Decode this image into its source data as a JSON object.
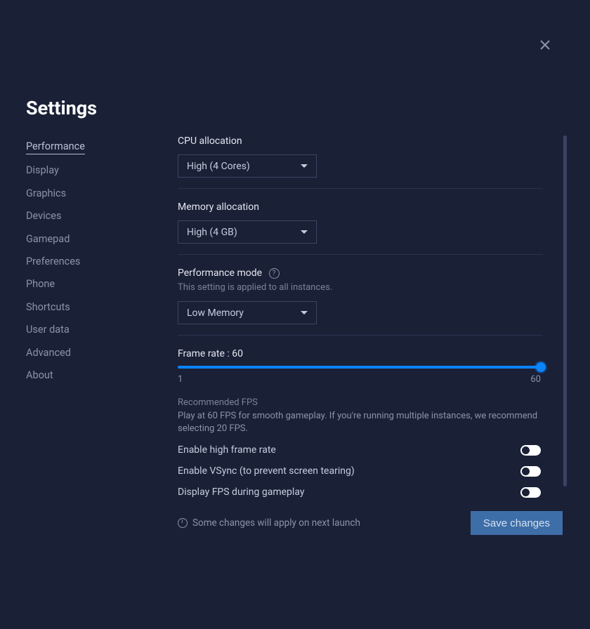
{
  "header": {
    "title": "Settings"
  },
  "sidebar": {
    "items": [
      {
        "label": "Performance",
        "active": true
      },
      {
        "label": "Display"
      },
      {
        "label": "Graphics"
      },
      {
        "label": "Devices"
      },
      {
        "label": "Gamepad"
      },
      {
        "label": "Preferences"
      },
      {
        "label": "Phone"
      },
      {
        "label": "Shortcuts"
      },
      {
        "label": "User data"
      },
      {
        "label": "Advanced"
      },
      {
        "label": "About"
      }
    ]
  },
  "main": {
    "cpu": {
      "label": "CPU allocation",
      "value": "High (4 Cores)"
    },
    "memory": {
      "label": "Memory allocation",
      "value": "High (4 GB)"
    },
    "perfmode": {
      "label": "Performance mode",
      "sub": "This setting is applied to all instances.",
      "value": "Low Memory"
    },
    "framerate": {
      "label": "Frame rate : 60",
      "min": "1",
      "max": "60",
      "reco_title": "Recommended FPS",
      "reco_body": "Play at 60 FPS for smooth gameplay. If you're running multiple instances, we recommend selecting 20 FPS."
    },
    "toggles": {
      "high_fps": "Enable high frame rate",
      "vsync": "Enable VSync (to prevent screen tearing)",
      "display_fps": "Display FPS during gameplay"
    }
  },
  "footer": {
    "note": "Some changes will apply on next launch",
    "save": "Save changes"
  }
}
